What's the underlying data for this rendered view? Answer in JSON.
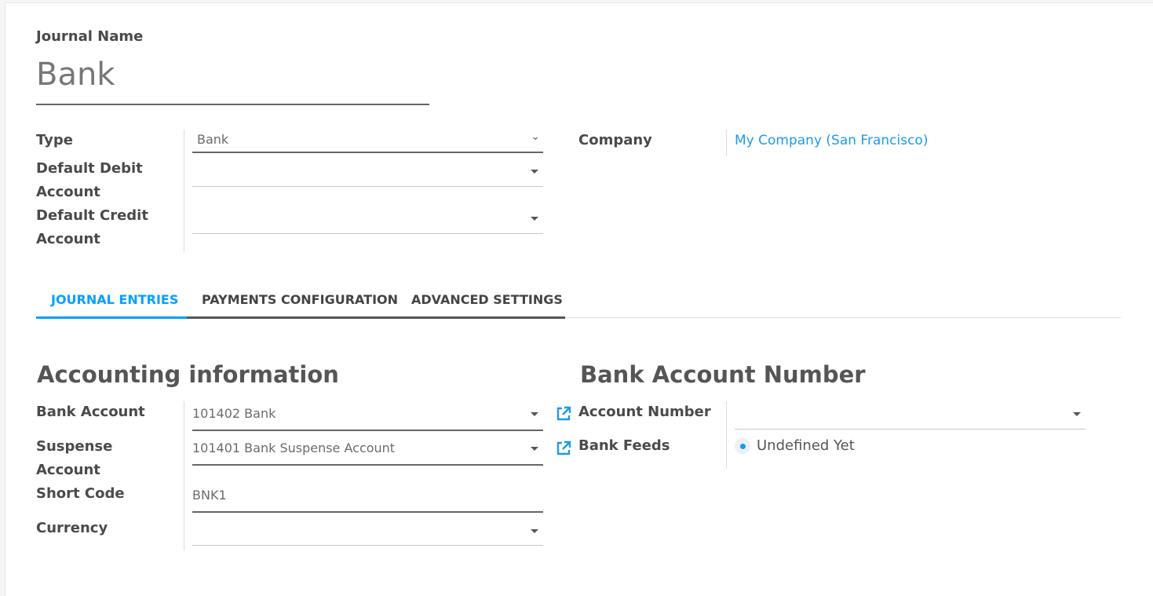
{
  "header": {
    "journal_name_label": "Journal Name",
    "journal_name_value": "Bank"
  },
  "fields": {
    "type_label": "Type",
    "type_value": "Bank",
    "debit_label_1": "Default Debit",
    "debit_label_2": "Account",
    "credit_label_1": "Default Credit",
    "credit_label_2": "Account",
    "company_label": "Company",
    "company_value": "My Company (San Francisco)"
  },
  "tabs": [
    {
      "label": "JOURNAL ENTRIES",
      "active": true
    },
    {
      "label": "PAYMENTS CONFIGURATION"
    },
    {
      "label": "ADVANCED SETTINGS"
    }
  ],
  "accounting": {
    "title": "Accounting information",
    "bank_account_label": "Bank Account",
    "bank_account_value": "101402 Bank",
    "suspense_label_1": "Suspense",
    "suspense_label_2": "Account",
    "suspense_value": "101401 Bank Suspense Account",
    "short_code_label": "Short Code",
    "short_code_value": "BNK1",
    "currency_label": "Currency"
  },
  "bank_account": {
    "title": "Bank Account Number",
    "account_number_label": "Account Number",
    "bank_feeds_label": "Bank Feeds",
    "bank_feeds_value": "Undefined Yet"
  },
  "colors": {
    "accent": "#00a0ff",
    "link": "#1e9be8"
  }
}
